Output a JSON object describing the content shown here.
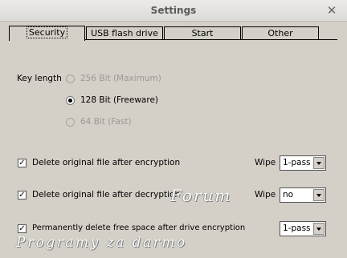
{
  "window": {
    "title": "Settings",
    "close_glyph": "✕"
  },
  "tabs": [
    {
      "label": "Security",
      "active": true
    },
    {
      "label": "USB flash drive",
      "active": false
    },
    {
      "label": "Start",
      "active": false
    },
    {
      "label": "Other",
      "active": false
    }
  ],
  "key_length": {
    "label": "Key length",
    "options": [
      {
        "label": "256 Bit (Maximum)",
        "selected": false,
        "enabled": false
      },
      {
        "label": "128 Bit (Freeware)",
        "selected": true,
        "enabled": true
      },
      {
        "label": "64 Bit (Fast)",
        "selected": false,
        "enabled": false
      }
    ]
  },
  "options": [
    {
      "label": "Delete original file after encryption",
      "checked": true,
      "wipe_label": "Wipe",
      "wipe_value": "1-pass"
    },
    {
      "label": "Delete original file after decryption",
      "checked": true,
      "wipe_label": "Wipe",
      "wipe_value": "no"
    },
    {
      "label": "Permanently delete free space after drive encryption",
      "checked": true,
      "wipe_value": "1-pass"
    }
  ],
  "watermark": {
    "line1": "Forum",
    "line2": "Programy za darmo"
  }
}
